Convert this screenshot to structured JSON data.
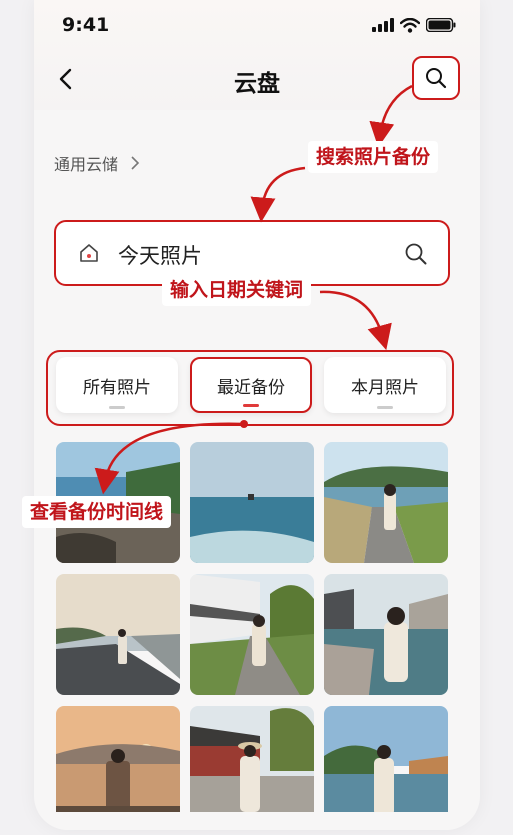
{
  "status": {
    "time": "9:41"
  },
  "nav": {
    "title": "云盘"
  },
  "storage": {
    "label": "通用云储"
  },
  "search": {
    "value": "今天照片"
  },
  "tabs": [
    {
      "label": "所有照片"
    },
    {
      "label": "最近备份",
      "active": true
    },
    {
      "label": "本月照片"
    }
  ],
  "annotations": {
    "search_photo": "搜索照片备份",
    "input_keyword": "输入日期关键词",
    "view_timeline": "查看备份时间线"
  },
  "colors": {
    "accent": "#cc1b1b"
  },
  "icons": [
    "back-arrow-icon",
    "search-icon",
    "home-icon",
    "chevron-right-icon",
    "signal-icon",
    "wifi-icon",
    "battery-icon"
  ]
}
